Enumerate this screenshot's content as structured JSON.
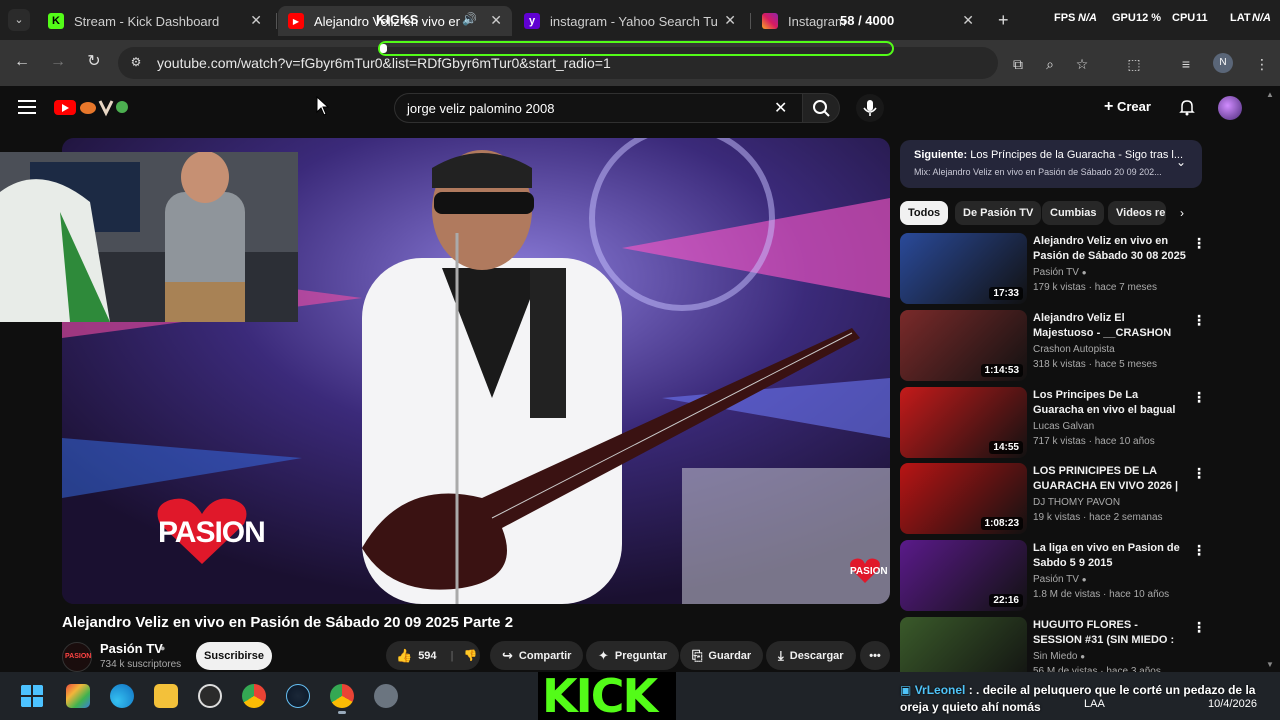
{
  "browser": {
    "tabs": [
      {
        "title": "Stream - Kick Dashboard",
        "icon": "kick-icon",
        "active": false
      },
      {
        "title": "Alejandro Veliz en vivo en Pasión de Sábado",
        "icon": "youtube-icon",
        "active": true
      },
      {
        "title": "instagram - Yahoo Search Tus r",
        "icon": "yahoo-icon",
        "active": false
      },
      {
        "title": "Instagram",
        "icon": "instagram-icon",
        "active": false
      }
    ],
    "overlay_kicks": "KICKS",
    "overlay_counter": "58 / 4000",
    "hud": {
      "fps_label": "FPS",
      "fps_value": "N/A",
      "gpu_label": "GPU",
      "gpu_value": "12 %",
      "cpu_label": "CPU",
      "cpu_value": "11",
      "lat_label": "LAT",
      "lat_value": "N/A"
    },
    "url": "youtube.com/watch?v=fGbyr6mTur0&list=RDfGbyr6mTur0&start_radio=1",
    "profile_initial": "N"
  },
  "youtube": {
    "search_query": "jorge veliz palomino 2008",
    "create_label": "Crear",
    "video": {
      "logo_text": "PASION",
      "small_logo_text": "PASION",
      "title": "Alejandro Veliz en vivo en Pasión de Sábado 20 09 2025 Parte 2",
      "channel": "Pasión TV",
      "channel_avatar_text": "PASION",
      "subscribers": "734 k suscriptores",
      "subscribe_label": "Suscribirse",
      "likes": "594",
      "share_label": "Compartir",
      "ask_label": "Preguntar",
      "save_label": "Guardar",
      "download_label": "Descargar"
    },
    "next": {
      "label": "Siguiente:",
      "title": "Los Príncipes de la Guaracha - Sigo tras l...",
      "mix": "Mix: Alejandro Veliz en vivo en Pasión de Sábado 20 09 202..."
    },
    "chips": [
      "Todos",
      "De Pasión TV",
      "Cumbias",
      "Videos re"
    ],
    "recommendations": [
      {
        "title": "Alejandro Veliz en vivo en Pasión de Sábado 30 08 2025 ...",
        "channel": "Pasión TV",
        "verified": true,
        "meta": "179 k vistas · hace 7 meses",
        "duration": "17:33",
        "thumb_color": "#2a4a9a"
      },
      {
        "title": "Alejandro Veliz El Majestuoso - __CRASHON Autopista__",
        "channel": "Crashon Autopista",
        "verified": false,
        "meta": "318 k vistas · hace 5 meses",
        "duration": "1:14:53",
        "thumb_color": "#7a2a2a"
      },
      {
        "title": "Los Principes De La Guaracha en vivo el bagual del loco luis ...",
        "channel": "Lucas Galvan",
        "verified": false,
        "meta": "717 k vistas · hace 10 años",
        "duration": "14:55",
        "thumb_color": "#c41a1a"
      },
      {
        "title": "LOS PRINICIPES DE LA GUARACHA EN VIVO 2026 | 3...",
        "channel": "DJ THOMY PAVON",
        "verified": false,
        "meta": "19 k vistas · hace 2 semanas",
        "duration": "1:08:23",
        "thumb_color": "#b81414"
      },
      {
        "title": "La liga en vivo en Pasion de Sabdo 5 9 2015",
        "channel": "Pasión TV",
        "verified": true,
        "meta": "1.8 M de vistas · hace 10 años",
        "duration": "22:16",
        "thumb_color": "#5a1a8a"
      },
      {
        "title": "HUGUITO FLORES - SESSION #31 (SIN MIEDO : LADO \"S\")",
        "channel": "Sin Miedo",
        "verified": true,
        "meta": "56 M de vistas · hace 3 años",
        "duration": "",
        "thumb_color": "#3a5a2a"
      }
    ]
  },
  "taskbar": {
    "kick_text": "KICK",
    "language": "LAA",
    "date": "10/4/2026"
  },
  "chat": {
    "user": "VrLeonel",
    "message": ": . decile al peluquero que le corté un pedazo de la oreja y quieto ahí nomás"
  },
  "colors": {
    "kick_green": "#53fc18",
    "yt_red": "#ff0000",
    "bg": "#0f0f0f"
  }
}
